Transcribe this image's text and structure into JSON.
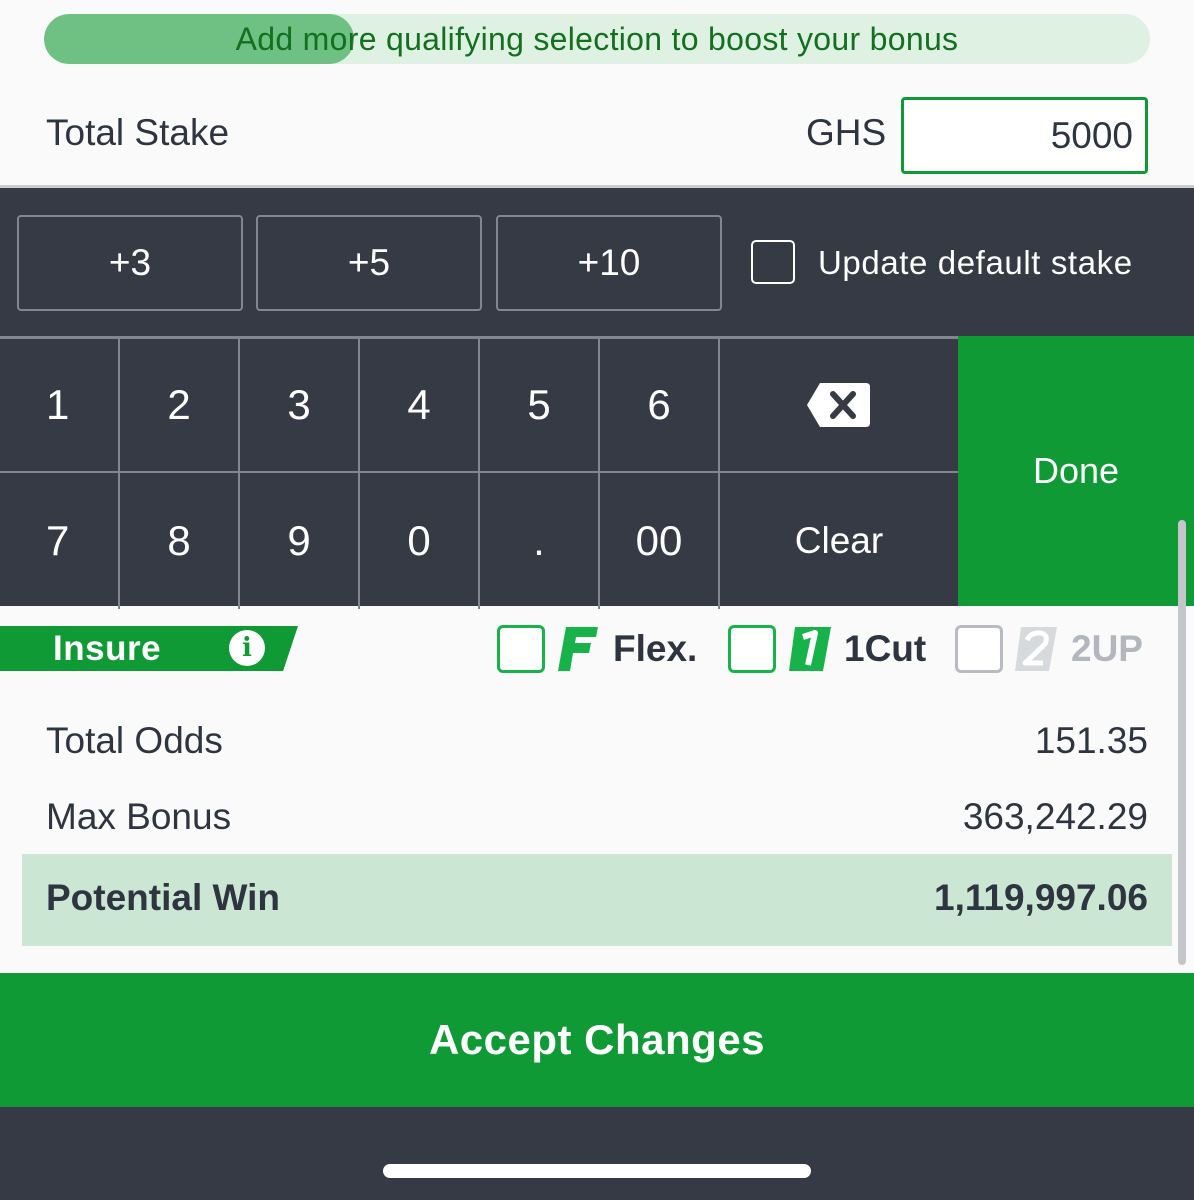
{
  "bonus_bar": {
    "text": "Add more qualifying selection to boost your bonus",
    "progress_fraction": 0.28
  },
  "stake": {
    "label": "Total Stake",
    "currency": "GHS",
    "value": "5000"
  },
  "quick_add": [
    {
      "label": "+3"
    },
    {
      "label": "+5"
    },
    {
      "label": "+10"
    }
  ],
  "default_stake": {
    "label": "Update default stake",
    "checked": false
  },
  "keypad": {
    "row1": [
      "1",
      "2",
      "3",
      "4",
      "5",
      "6"
    ],
    "row2": [
      "7",
      "8",
      "9",
      "0",
      ".",
      "00"
    ],
    "backspace_icon": "backspace-icon",
    "clear_label": "Clear",
    "done_label": "Done"
  },
  "insure": {
    "label": "Insure",
    "info_glyph": "i"
  },
  "options": [
    {
      "glyph": "F",
      "label": "Flex.",
      "enabled": true
    },
    {
      "glyph": "1",
      "label": "1Cut",
      "enabled": true
    },
    {
      "glyph": "2",
      "label": "2UP",
      "enabled": false
    }
  ],
  "summary": {
    "total_odds_label": "Total Odds",
    "total_odds_value": "151.35",
    "max_bonus_label": "Max Bonus",
    "max_bonus_value": "363,242.29",
    "potential_win_label": "Potential Win",
    "potential_win_value": "1,119,997.06"
  },
  "accept_label": "Accept Changes",
  "colors": {
    "accent_green": "#0f9a35",
    "keypad_bg": "#353a45",
    "highlight_band": "#cbe6d3"
  }
}
